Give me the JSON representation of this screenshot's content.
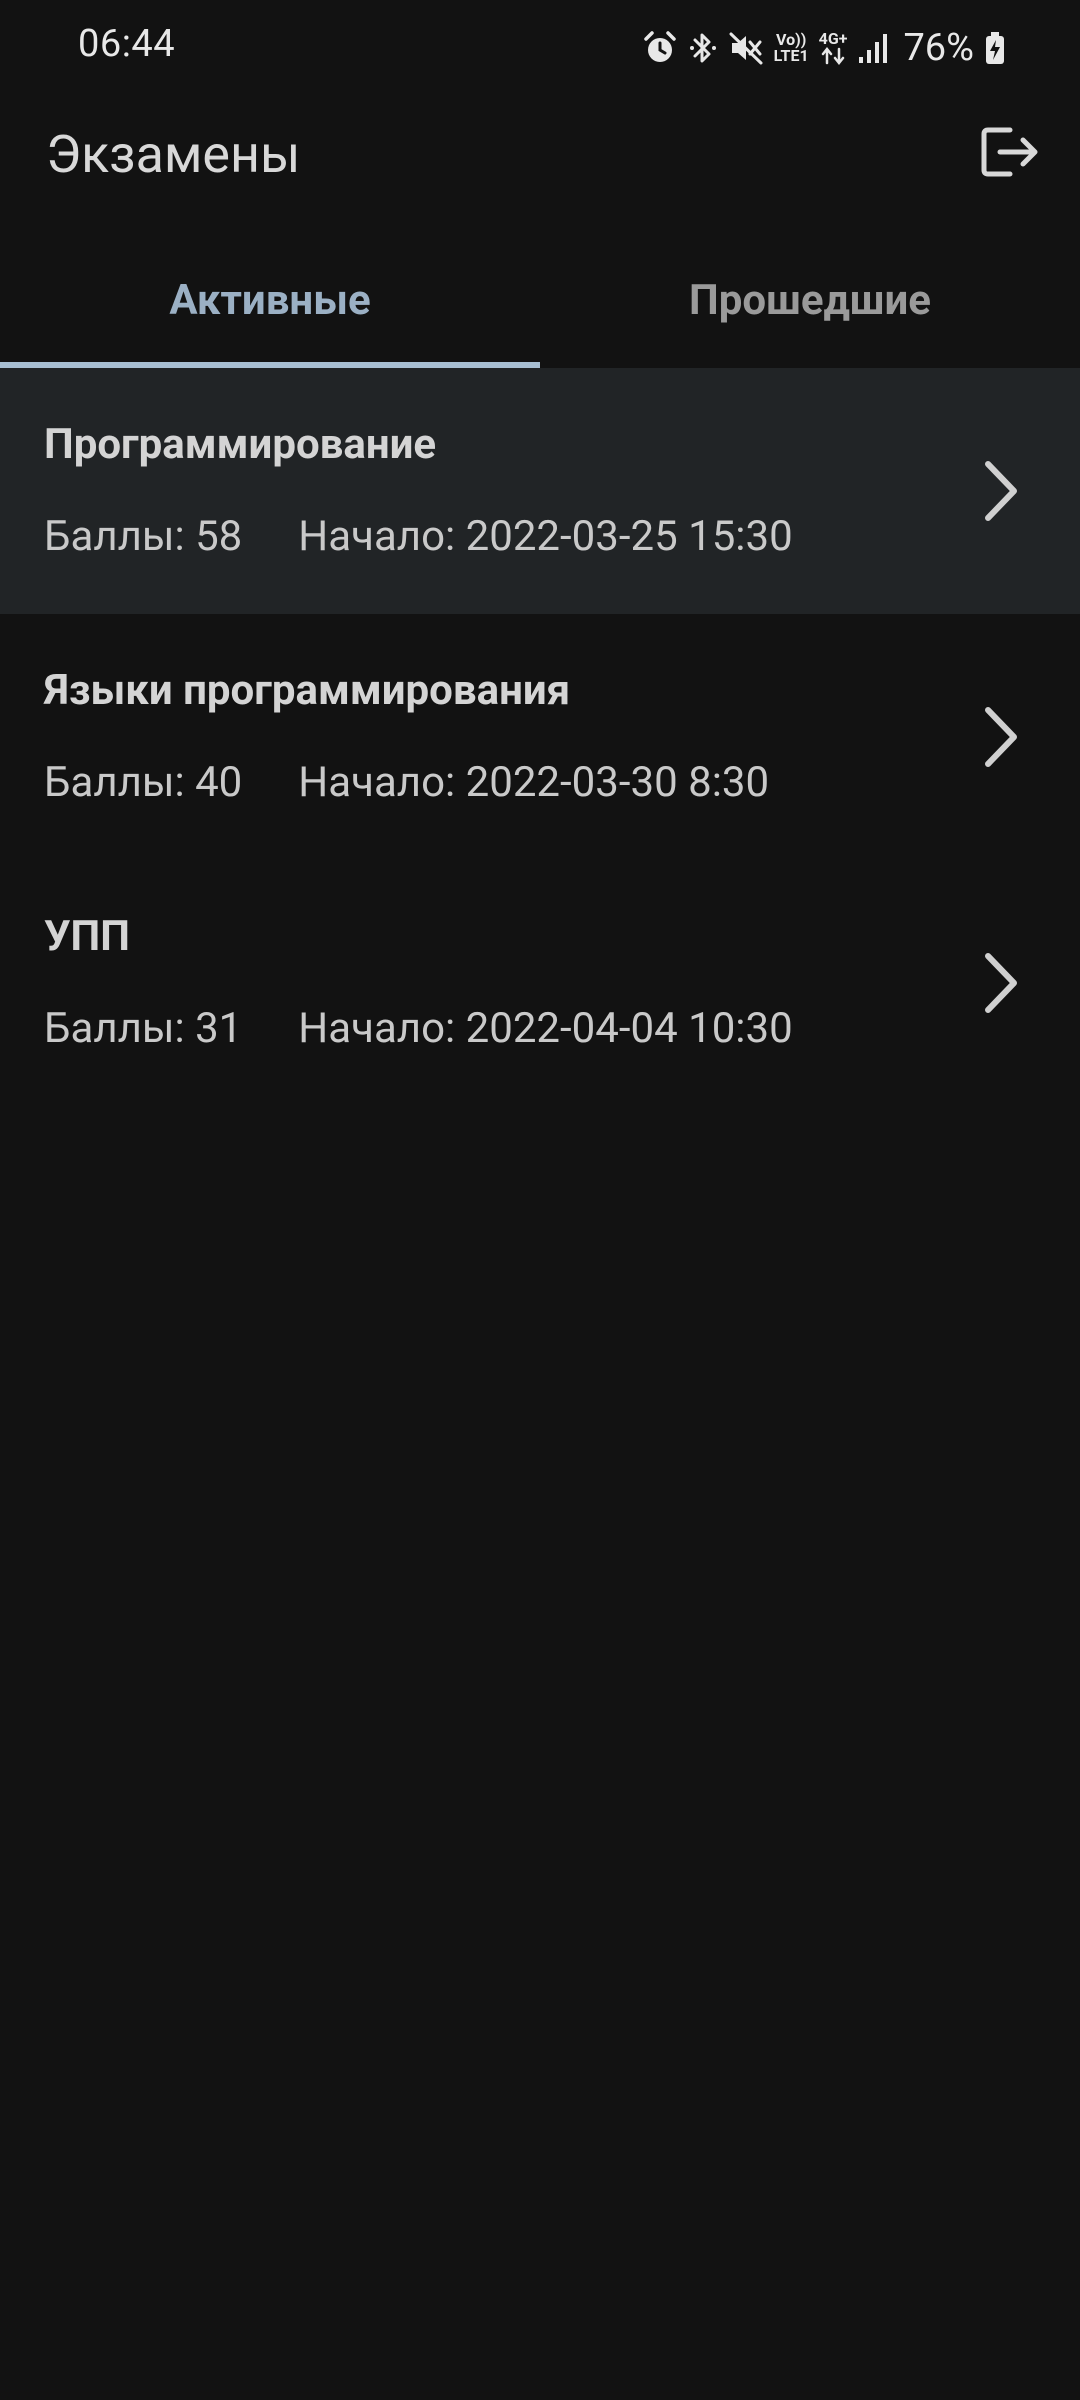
{
  "status_bar": {
    "time": "06:44",
    "network_top": "Vo))",
    "network_bottom": "LTE1",
    "data_type": "4G+",
    "battery_percent": "76%",
    "icons": [
      "alarm-icon",
      "bluetooth-icon",
      "mute-icon",
      "volte-icon",
      "4g-plus-icon",
      "signal-icon",
      "battery-charging-icon"
    ]
  },
  "app_bar": {
    "title": "Экзамены",
    "logout_icon": "logout-icon"
  },
  "tabs": [
    {
      "label": "Активные",
      "active": true
    },
    {
      "label": "Прошедшие",
      "active": false
    }
  ],
  "exams": [
    {
      "name": "Программирование",
      "points": "Баллы: 58",
      "start": "Начало: 2022-03-25 15:30",
      "selected": true
    },
    {
      "name": "Языки программирования",
      "points": "Баллы: 40",
      "start": "Начало: 2022-03-30 8:30",
      "selected": false
    },
    {
      "name": "УПП",
      "points": "Баллы: 31",
      "start": "Начало: 2022-04-04 10:30",
      "selected": false
    }
  ],
  "colors": {
    "background": "#121212",
    "selected_row": "#212426",
    "tab_active": "#9bb0c4",
    "tab_indicator": "#a8bfd2",
    "tab_inactive": "#9a9a9a"
  }
}
